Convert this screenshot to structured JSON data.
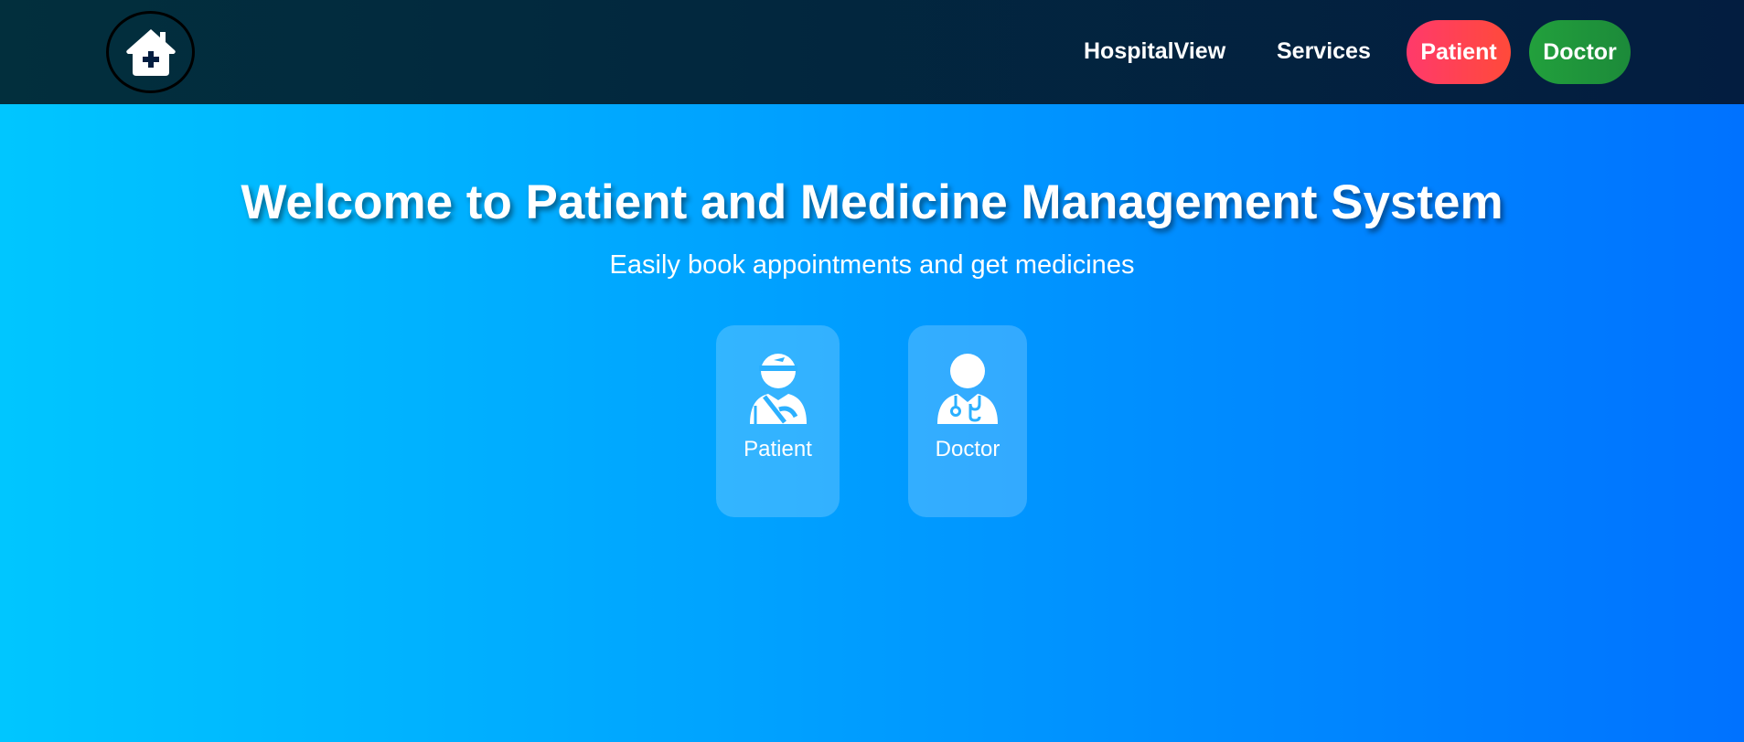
{
  "nav": {
    "logo_icon": "home-medical-icon",
    "links": [
      "HospitalView",
      "Services"
    ],
    "patient_button": "Patient",
    "doctor_button": "Doctor"
  },
  "hero": {
    "title": "Welcome to Patient and Medicine Management System",
    "subtitle": "Easily book appointments and get medicines"
  },
  "cards": [
    {
      "label": "Patient",
      "icon": "patient-icon"
    },
    {
      "label": "Doctor",
      "icon": "doctor-icon"
    }
  ],
  "colors": {
    "background_start": "#00c6ff",
    "background_end": "#0072ff",
    "navbar": "#031d40",
    "patient_button": "#ff4159",
    "doctor_button": "#1f943b"
  }
}
